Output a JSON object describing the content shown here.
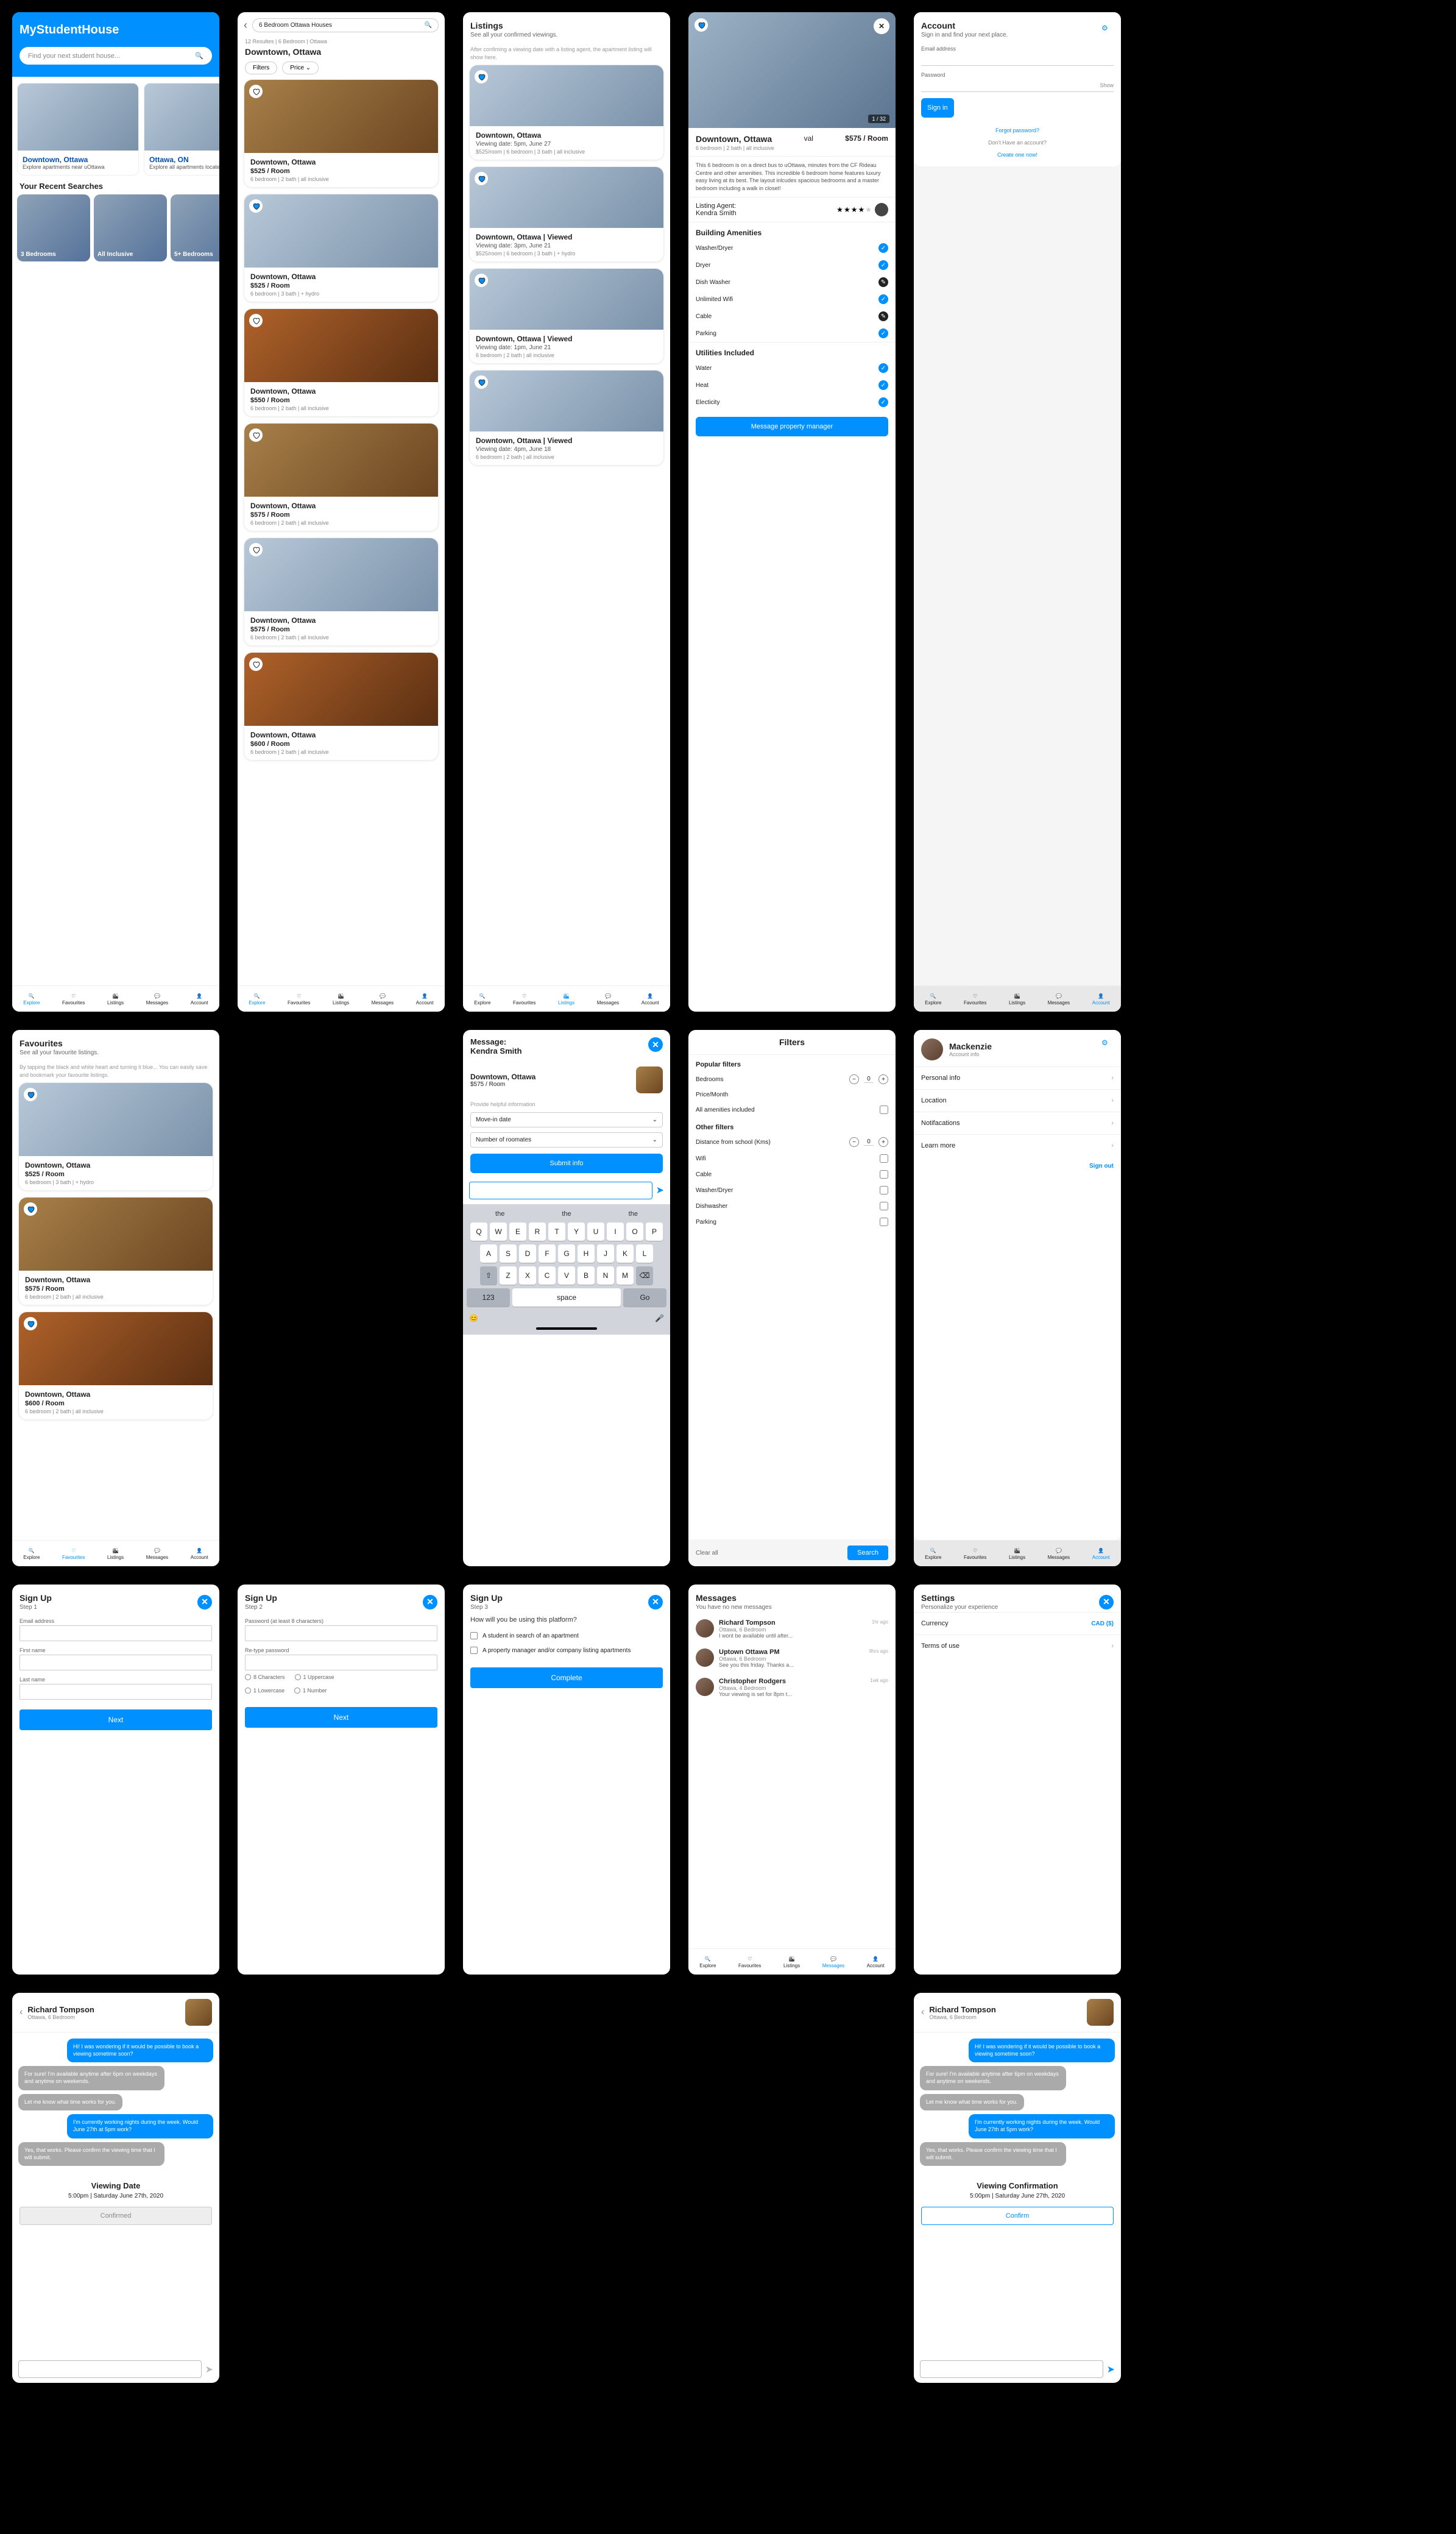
{
  "tabs": {
    "explore": "Explore",
    "favourites": "Favourites",
    "listings": "Listings",
    "messages": "Messages",
    "account": "Account"
  },
  "explore": {
    "brand": "MyStudentHouse",
    "search_placeholder": "Find your next student house...",
    "promos": [
      {
        "title": "Downtown, Ottawa",
        "sub": "Explore apartments near uOttawa"
      },
      {
        "title": "Ottawa, ON",
        "sub": "Explore all apartments located in Ottawa"
      }
    ],
    "recent_h": "Your Recent Searches",
    "chips": [
      "3 Bedrooms",
      "All Inclusive",
      "5+ Bedrooms"
    ]
  },
  "results": {
    "search_value": "6 Bedroom Ottawa Houses",
    "meta": "12 Resultes | 6 Bedroom | Ottawa",
    "city": "Downtown, Ottawa",
    "filters_label": "Filters",
    "price_label": "Price ⌄",
    "items": [
      {
        "title": "Downtown, Ottawa",
        "price": "$525 / Room",
        "meta": "6 bedroom | 2 bath | all inclusive"
      },
      {
        "title": "Downtown, Ottawa",
        "price": "$525 / Room",
        "meta": "6 bedroom | 3 bath | + hydro"
      },
      {
        "title": "Downtown, Ottawa",
        "price": "$550 / Room",
        "meta": "6 bedroom | 2 bath | all inclusive"
      },
      {
        "title": "Downtown, Ottawa",
        "price": "$575 / Room",
        "meta": "6 bedroom | 2 bath | all inclusive"
      },
      {
        "title": "Downtown, Ottawa",
        "price": "$575 / Room",
        "meta": "6 bedroom | 2 bath | all inclusive"
      },
      {
        "title": "Downtown, Ottawa",
        "price": "$600 / Room",
        "meta": "6 bedroom | 2 bath | all inclusive"
      }
    ]
  },
  "listings": {
    "title": "Listings",
    "sub": "See all your confirmed viewings.",
    "helper": "After confiming a viewing date with a listing agent, the apartment listing will show here.",
    "items": [
      {
        "title": "Downtown, Ottawa",
        "date": "Viewing date: 5pm, June 27",
        "meta": "$525/room | 6 bedroom | 3 bath | all inclusive"
      },
      {
        "title": "Downtown, Ottawa | Viewed",
        "date": "Viewing date: 3pm, June 21",
        "meta": "$525/room | 6 bedroom | 3 bath | + hydro"
      },
      {
        "title": "Downtown, Ottawa | Viewed",
        "date": "Viewing date: 1pm, June 21",
        "meta": "6 bedroom | 2 bath | all inclusive"
      },
      {
        "title": "Downtown, Ottawa | Viewed",
        "date": "Viewing date: 4pm, June 18",
        "meta": "6 bedroom | 2 bath | all inclusive"
      }
    ]
  },
  "detail": {
    "counter": "1 / 32",
    "title": "Downtown, Ottawa",
    "price": "$575 / Room",
    "meta": "6 bedroom | 2 bath | all inclusive",
    "desc": "This 6 bedroom is on a direct bus to uOttawa, minutes from the CF Rideau Centre and other amenities. This incredible 6 bedroom home features luxury easy living at its best. The layout inlcudes spacious bedrooms and a master bedroom including a walk in closet!",
    "agent_label": "Listing Agent:",
    "agent_name": "Kendra Smith",
    "amen_h": "Building Amenities",
    "amenities": [
      {
        "name": "Washer/Dryer",
        "yes": true
      },
      {
        "name": "Dryer",
        "yes": true
      },
      {
        "name": "Dish Washer",
        "yes": false
      },
      {
        "name": "Unlimited Wifi",
        "yes": true
      },
      {
        "name": "Cable",
        "yes": false
      },
      {
        "name": "Parking",
        "yes": true
      }
    ],
    "util_h": "Utilities Included",
    "utilities": [
      {
        "name": "Water",
        "yes": true
      },
      {
        "name": "Heat",
        "yes": true
      },
      {
        "name": "Electicity",
        "yes": true
      }
    ],
    "cta": "Message property manager"
  },
  "account_login": {
    "title": "Account",
    "sub": "Sign in and find your next place.",
    "email_label": "Email address",
    "password_label": "Password",
    "show": "Show",
    "signin": "Sign in",
    "forgot": "Forgot password?",
    "no_account": "Don't Have an account?",
    "create": "Create one now!"
  },
  "favourites": {
    "title": "Favourites",
    "sub": "See all your favourite listings.",
    "helper": "By tapping the black and white heart and turning it blue... You can easily save and bookmark your favourite listings.",
    "items": [
      {
        "title": "Downtown, Ottawa",
        "price": "$525 / Room",
        "meta": "6 bedroom | 3 bath | + hydro"
      },
      {
        "title": "Downtown, Ottawa",
        "price": "$575 / Room",
        "meta": "6 bedroom | 2 bath | all inclusive"
      },
      {
        "title": "Downtown, Ottawa",
        "price": "$600 / Room",
        "meta": "6 bedroom | 2 bath | all inclusive"
      }
    ]
  },
  "profile": {
    "name": "Mackenzie",
    "sub": "Account info",
    "menu": [
      "Personal info",
      "Location",
      "Notifacations",
      "Learn more"
    ],
    "signout": "Sign out"
  },
  "filters": {
    "title": "Filters",
    "popular_h": "Popular filters",
    "bedrooms": "Bedrooms",
    "bedrooms_val": "0",
    "price": "Price/Month",
    "all_amen": "All amenities included",
    "other_h": "Other filters",
    "distance": "Distance from school (Kms)",
    "distance_val": "0",
    "rows": [
      "Wifi",
      "Cable",
      "Washer/Dryer",
      "Dishwasher",
      "Parking"
    ],
    "clear": "Clear all",
    "search": "Search"
  },
  "settings": {
    "title": "Settings",
    "sub": "Personalize your experience",
    "currency": "Currency",
    "currency_val": "CAD ($)",
    "terms": "Terms of use"
  },
  "signup1": {
    "title": "Sign Up",
    "step": "Step 1",
    "email": "Email address",
    "first": "First name",
    "last": "Last name",
    "next": "Next"
  },
  "signup2": {
    "title": "Sign Up",
    "step": "Step 2",
    "pw": "Password (at least 8 characters)",
    "repw": "Re-type password",
    "reqs": [
      "8 Characters",
      "1 Uppercase",
      "1 Lowercase",
      "1 Number"
    ],
    "next": "Next"
  },
  "signup3": {
    "title": "Sign Up",
    "step": "Step 3",
    "q": "How will you be using this platform?",
    "opt1": "A student in search of an apartment",
    "opt2": "A property manager and/or company listing apartments",
    "complete": "Complete"
  },
  "msgform": {
    "title": "Message:",
    "name": "Kendra Smith",
    "listing": "Downtown, Ottawa",
    "price": "$575 / Room",
    "helper": "Provide helpful information",
    "move": "Move-in date",
    "roommates": "Number of roomates",
    "submit": "Submit info",
    "sugg": [
      "the",
      "the",
      "the"
    ],
    "keys1": [
      "Q",
      "W",
      "E",
      "R",
      "T",
      "Y",
      "U",
      "I",
      "O",
      "P"
    ],
    "keys2": [
      "A",
      "S",
      "D",
      "F",
      "G",
      "H",
      "J",
      "K",
      "L"
    ],
    "keys3": [
      "Z",
      "X",
      "C",
      "V",
      "B",
      "N",
      "M"
    ],
    "k123": "123",
    "space": "space",
    "go": "Go"
  },
  "messages": {
    "title": "Messages",
    "sub": "You have no new messages",
    "items": [
      {
        "name": "Richard Tompson",
        "sub": "Ottawa, 6 Bedroom",
        "preview": "I wont be available until after...",
        "time": "1hr ago"
      },
      {
        "name": "Uptown Ottawa PM",
        "sub": "Ottawa, 6 Bedroom",
        "preview": "See you this friday. Thanks a...",
        "time": "8hrs ago"
      },
      {
        "name": "Christopher Rodgers",
        "sub": "Ottawa, 4 Bedroom",
        "preview": "Your viewing is set for 8pm t...",
        "time": "1wk ago"
      }
    ]
  },
  "chat": {
    "name": "Richard Tompson",
    "sub": "Ottawa, 6 Bedroom",
    "msgs": [
      {
        "dir": "out",
        "text": "Hi! I was wondering if it would be possible to book a viewing sometime soon?"
      },
      {
        "dir": "in",
        "text": "For sure! I'm available anytime after 6pm on weekdays and anytime on weekends."
      },
      {
        "dir": "in",
        "text": "Let me know what time works for you."
      },
      {
        "dir": "out",
        "text": "I'm currently working nights during the week. Would June 27th at 5pm work?"
      },
      {
        "dir": "in",
        "text": "Yes, that works. Please confirm the viewing time that I will submit."
      }
    ],
    "conf_h": "Viewing Date",
    "conf_date": "5:00pm | Saturday June 27th, 2020",
    "confirmed": "Confirmed",
    "conf_h2": "Viewing Confirmation",
    "confirm": "Confirm"
  }
}
